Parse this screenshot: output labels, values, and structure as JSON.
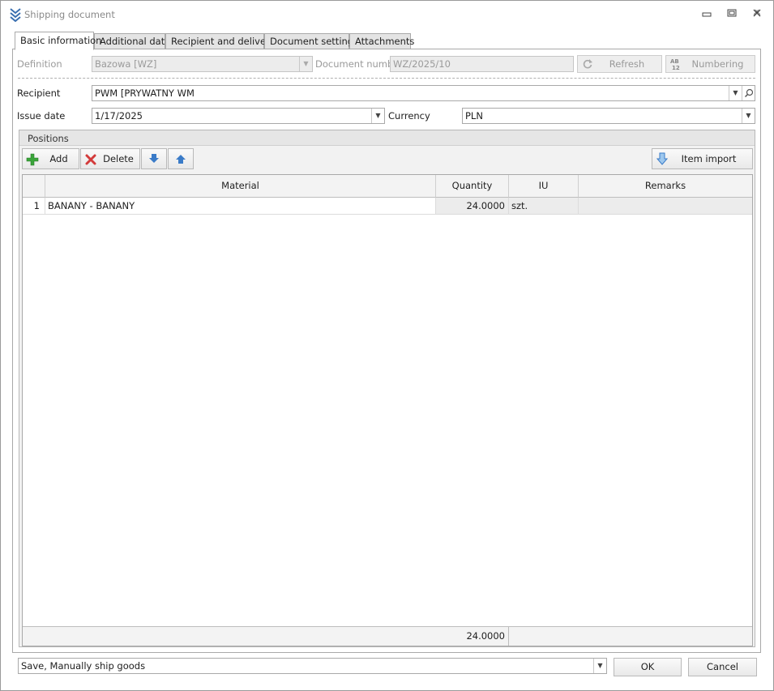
{
  "window": {
    "title": "Shipping document",
    "controls": [
      "minimize",
      "restore",
      "close"
    ]
  },
  "tabs": [
    {
      "label": "Basic information",
      "active": true
    },
    {
      "label": "Additional data",
      "active": false
    },
    {
      "label": "Recipient and delivery",
      "active": false
    },
    {
      "label": "Document settings",
      "active": false
    },
    {
      "label": "Attachments",
      "active": false
    }
  ],
  "header": {
    "definition_label": "Definition",
    "definition_value": "Bazowa [WZ]",
    "docnum_label": "Document number",
    "docnum_value": "WZ/2025/10",
    "refresh_label": "Refresh",
    "numbering_label": "Numbering",
    "recipient_label": "Recipient",
    "recipient_value": "PWM [PRYWATNY WM",
    "issue_date_label": "Issue date",
    "issue_date_value": "1/17/2025",
    "currency_label": "Currency",
    "currency_value": "PLN"
  },
  "positions": {
    "title": "Positions",
    "toolbar": {
      "add_label": "Add",
      "delete_label": "Delete",
      "import_label": "Item import"
    },
    "columns": [
      "Material",
      "Quantity",
      "IU",
      "Remarks"
    ],
    "rows": [
      {
        "num": "1",
        "material": "BANANY - BANANY",
        "quantity": "24.0000",
        "iu": "szt.",
        "remarks": ""
      }
    ],
    "total_quantity": "24.0000"
  },
  "bottom": {
    "action_value": "Save, Manually ship goods",
    "ok_label": "OK",
    "cancel_label": "Cancel"
  },
  "colors": {
    "add_icon": "#3aa53a",
    "delete_icon": "#d33b3b",
    "arrow_icon": "#3a7bc8"
  }
}
